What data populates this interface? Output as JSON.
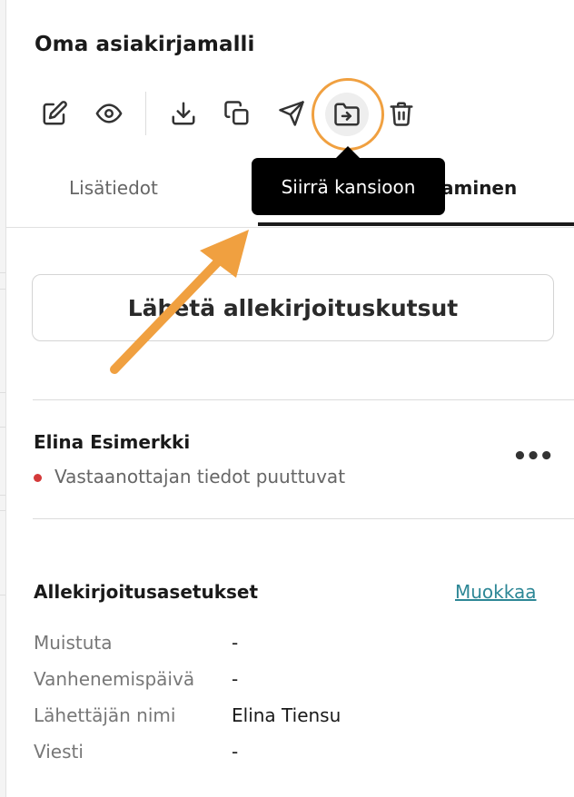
{
  "document": {
    "title": "Oma asiakirjamalli"
  },
  "toolbar": {
    "items": [
      {
        "name": "edit",
        "icon": "pencil-square-icon"
      },
      {
        "name": "preview",
        "icon": "eye-icon"
      },
      {
        "name": "download",
        "icon": "download-icon"
      },
      {
        "name": "copy",
        "icon": "copy-icon"
      },
      {
        "name": "send",
        "icon": "paper-plane-icon"
      },
      {
        "name": "move-to-folder",
        "icon": "folder-arrow-icon"
      },
      {
        "name": "delete",
        "icon": "trash-icon"
      }
    ],
    "tooltip": "Siirrä kansioon"
  },
  "tabs": {
    "info": "Lisätiedot",
    "sign_partial": "aminen"
  },
  "send_button": {
    "label": "Lähetä allekirjoituskutsut"
  },
  "recipient": {
    "name": "Elina Esimerkki",
    "status": "Vastaanottajan tiedot puuttuvat",
    "status_color": "#d43a3a",
    "more": "•••"
  },
  "settings": {
    "title": "Allekirjoitusasetukset",
    "edit_label": "Muokkaa",
    "rows": [
      {
        "label": "Muistuta",
        "value": "-"
      },
      {
        "label": "Vanhenemispäivä",
        "value": "-"
      },
      {
        "label": "Lähettäjän nimi",
        "value": "Elina Tiensu"
      },
      {
        "label": "Viesti",
        "value": "-"
      }
    ]
  },
  "colors": {
    "accent_annotation": "#f0a040",
    "link": "#2d8796"
  }
}
